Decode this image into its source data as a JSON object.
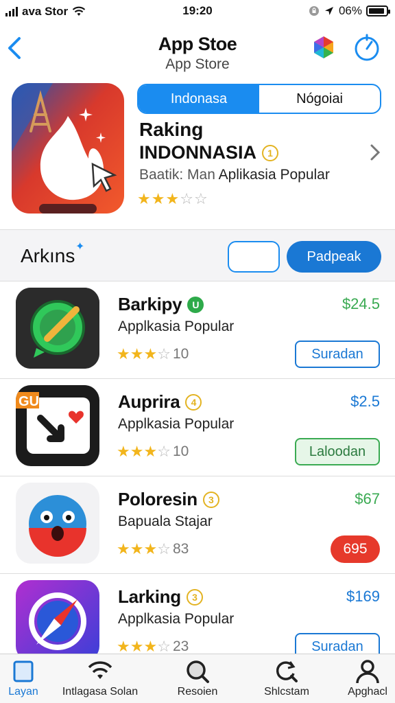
{
  "status": {
    "carrier": "ava Stor",
    "time": "19:20",
    "battery": "06%",
    "icons": [
      "signal-icon",
      "wifi-icon",
      "lock-rotation-icon",
      "location-arrow-icon",
      "battery-icon"
    ],
    "battery_level": 0.9
  },
  "nav": {
    "title": "App Stoe",
    "subtitle": "App Store",
    "icons": [
      "back-chevron-icon",
      "store-logo-icon",
      "timer-icon"
    ]
  },
  "featured": {
    "segments": [
      {
        "label": "Indonasa",
        "active": true
      },
      {
        "label": "Nógoiai",
        "active": false
      }
    ],
    "title": "Raking",
    "country": "INDONNASIA",
    "rank_badge": "1",
    "desc_prefix": "Baatik: Man",
    "desc_main": "Aplikasia Popular",
    "rating": 3,
    "rating_max": 5,
    "accent": "#1a8cf0"
  },
  "section": {
    "title": "Arkıns",
    "action_label": "Padpeak"
  },
  "apps": [
    {
      "name": "Barkipy",
      "badge": "U",
      "subtitle": "Applkasia Popular",
      "rating": 3,
      "count": "10",
      "price": "$24.5",
      "price_color": "#3aaa52",
      "action": "Suradan",
      "action_style": "outline",
      "icon": "chat-pencil-icon"
    },
    {
      "name": "Auprira",
      "badge": "4",
      "subtitle": "Applkasia Popular",
      "rating": 3,
      "count": "10",
      "price": "$2.5",
      "price_color": "#1a78d4",
      "action": "Laloodan",
      "action_style": "green",
      "icon": "gu-arrow-heart-icon"
    },
    {
      "name": "Poloresin",
      "badge": "3",
      "subtitle": "Bapuala Stajar",
      "rating": 3,
      "count": "83",
      "price": "$67",
      "price_color": "#3aaa52",
      "action": "695",
      "action_style": "red",
      "icon": "surprised-face-icon"
    },
    {
      "name": "Larking",
      "badge": "3",
      "subtitle": "Applkasia Popular",
      "rating": 3,
      "count": "23",
      "price": "$169",
      "price_color": "#1a78d4",
      "action": "Suradan",
      "action_style": "outline",
      "icon": "compass-icon"
    }
  ],
  "tabs": [
    {
      "label": "Layan",
      "icon": "layers-icon",
      "active": true
    },
    {
      "label": "Intlagasa Solan",
      "icon": "wifi-icon",
      "active": false
    },
    {
      "label": "Resoien",
      "icon": "search-icon",
      "active": false
    },
    {
      "label": "Shlcstam",
      "icon": "refresh-search-icon",
      "active": false
    },
    {
      "label": "Apghacl",
      "icon": "person-icon",
      "active": false
    }
  ]
}
